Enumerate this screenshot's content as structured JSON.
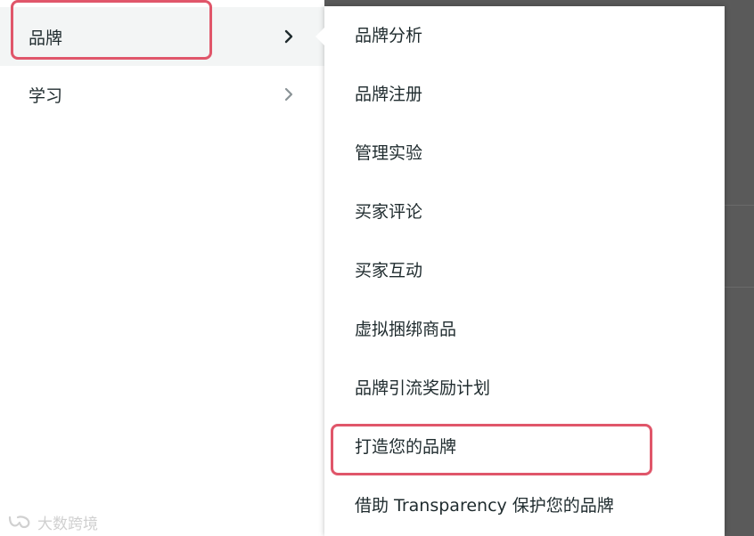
{
  "left_menu": {
    "items": [
      {
        "label": "品牌",
        "active": true,
        "icon": "chevron-right-icon"
      },
      {
        "label": "学习",
        "active": false,
        "icon": "chevron-right-icon"
      }
    ]
  },
  "submenu": {
    "items": [
      {
        "label": "品牌分析"
      },
      {
        "label": "品牌注册"
      },
      {
        "label": "管理实验"
      },
      {
        "label": "买家评论"
      },
      {
        "label": "买家互动"
      },
      {
        "label": "虚拟捆绑商品"
      },
      {
        "label": "品牌引流奖励计划"
      },
      {
        "label": "打造您的品牌"
      },
      {
        "label": "借助 Transparency 保护您的品牌"
      }
    ]
  },
  "annotations": {
    "highlight_color": "#e0566a"
  },
  "watermark": {
    "text": "大数跨境"
  },
  "colors": {
    "text": "#1f2b2e",
    "active_bg": "#f3f5f5",
    "overlay": "#5a5a5a"
  }
}
